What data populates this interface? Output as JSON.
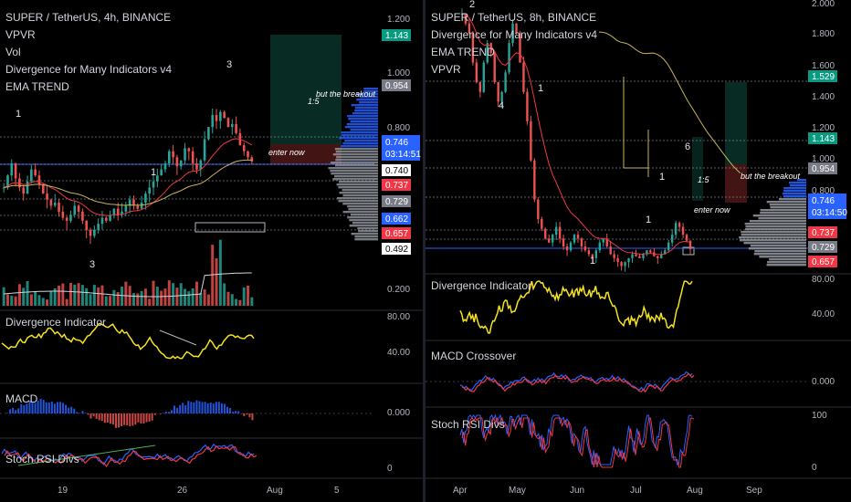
{
  "left": {
    "legend": [
      "SUPER / TetherUS, 4h, BINANCE",
      "VPVR",
      "Vol",
      "Divergence for Many Indicators v4",
      "EMA TREND"
    ],
    "price_ticks": [
      "1.200",
      "1.000",
      "0.800"
    ],
    "tags": [
      {
        "text": "1.143",
        "color": "#089981"
      },
      {
        "text": "0.954",
        "color": "#787b86"
      },
      {
        "text": "0.746",
        "color": "#2962ff"
      },
      {
        "text": "03:14:51",
        "color": "#2962ff"
      },
      {
        "text": "0.740",
        "color": "#ffffff"
      },
      {
        "text": "0.737",
        "color": "#f23645"
      },
      {
        "text": "0.729",
        "color": "#787b86"
      },
      {
        "text": "0.662",
        "color": "#2962ff"
      },
      {
        "text": "0.657",
        "color": "#f23645"
      },
      {
        "text": "0.492",
        "color": "#ffffff"
      }
    ],
    "vol_tick": "0.200",
    "div_label": "Divergence Indicator",
    "div_ticks": [
      "80.00",
      "40.00"
    ],
    "macd_label": "MACD",
    "macd_tick": "0.000",
    "stoch_label": "Stoch RSI Divs",
    "stoch_tick": "0",
    "x_ticks": [
      "19",
      "26",
      "Aug",
      "5"
    ],
    "waves": [
      "1",
      "1",
      "3",
      "3"
    ],
    "annotations": {
      "breakout": "but the breakout",
      "ratio": "1:5",
      "enter": "enter now"
    }
  },
  "right": {
    "legend": [
      "SUPER / TetherUS, 8h, BINANCE",
      "Divergence for Many Indicators v4",
      "EMA TREND",
      "VPVR"
    ],
    "price_ticks": [
      "2.000",
      "1.800",
      "1.600",
      "1.400",
      "1.200",
      "1.000",
      "0.800"
    ],
    "tags": [
      {
        "text": "1.529",
        "color": "#089981"
      },
      {
        "text": "1.143",
        "color": "#089981"
      },
      {
        "text": "0.954",
        "color": "#787b86"
      },
      {
        "text": "0.746",
        "color": "#2962ff"
      },
      {
        "text": "03:14:50",
        "color": "#2962ff"
      },
      {
        "text": "0.737",
        "color": "#f23645"
      },
      {
        "text": "0.729",
        "color": "#787b86"
      },
      {
        "text": "0.657",
        "color": "#f23645"
      }
    ],
    "div_label": "Divergence Indicator",
    "div_ticks": [
      "80.00",
      "40.00"
    ],
    "macd_label": "MACD Crossover",
    "macd_tick": "0.000",
    "stoch_label": "Stoch RSI Divs",
    "stoch_ticks": [
      "100",
      "0"
    ],
    "x_ticks": [
      "Apr",
      "May",
      "Jun",
      "Jul",
      "Aug",
      "Sep"
    ],
    "waves": [
      "2",
      "1",
      "4",
      "1",
      "1",
      "1",
      "6"
    ],
    "annotations": {
      "breakout": "but the breakout",
      "ratio": "1:5",
      "enter": "enter now"
    }
  },
  "chart_data": [
    {
      "type": "candlestick",
      "title": "SUPER / TetherUS, 4h, BINANCE",
      "ylim": [
        0.45,
        1.22
      ],
      "x_ticks": [
        "19",
        "26",
        "Aug",
        "5"
      ],
      "close_series": [
        0.66,
        0.7,
        0.74,
        0.69,
        0.66,
        0.64,
        0.68,
        0.72,
        0.7,
        0.67,
        0.64,
        0.62,
        0.6,
        0.61,
        0.58,
        0.56,
        0.55,
        0.57,
        0.6,
        0.58,
        0.55,
        0.52,
        0.5,
        0.52,
        0.54,
        0.56,
        0.55,
        0.57,
        0.59,
        0.57,
        0.58,
        0.6,
        0.62,
        0.6,
        0.59,
        0.61,
        0.64,
        0.66,
        0.68,
        0.7,
        0.72,
        0.74,
        0.78,
        0.76,
        0.73,
        0.75,
        0.79,
        0.78,
        0.74,
        0.72,
        0.75,
        0.82,
        0.86,
        0.9,
        0.88,
        0.91,
        0.89,
        0.86,
        0.87,
        0.84,
        0.8,
        0.78,
        0.76,
        0.746
      ],
      "last_price": 0.746,
      "series": [
        {
          "name": "EMA",
          "color": "#f23645"
        },
        {
          "name": "EMA",
          "color": "#c8b45a"
        }
      ]
    },
    {
      "type": "candlestick",
      "title": "SUPER / TetherUS, 8h, BINANCE",
      "ylim": [
        0.62,
        2.02
      ],
      "x_ticks": [
        "Apr",
        "May",
        "Jun",
        "Jul",
        "Aug",
        "Sep"
      ],
      "close_series": [
        1.95,
        1.9,
        1.85,
        1.7,
        1.6,
        1.55,
        1.7,
        1.8,
        1.75,
        1.6,
        1.5,
        1.55,
        1.65,
        1.8,
        1.9,
        1.85,
        1.7,
        1.55,
        1.4,
        1.2,
        1.0,
        0.9,
        0.85,
        0.8,
        0.78,
        0.82,
        0.86,
        0.8,
        0.76,
        0.74,
        0.78,
        0.82,
        0.8,
        0.76,
        0.74,
        0.72,
        0.7,
        0.74,
        0.78,
        0.8,
        0.76,
        0.72,
        0.7,
        0.68,
        0.66,
        0.68,
        0.7,
        0.72,
        0.71,
        0.7,
        0.72,
        0.74,
        0.73,
        0.71,
        0.7,
        0.72,
        0.74,
        0.78,
        0.82,
        0.88,
        0.86,
        0.82,
        0.79,
        0.746
      ],
      "last_price": 0.746
    }
  ]
}
